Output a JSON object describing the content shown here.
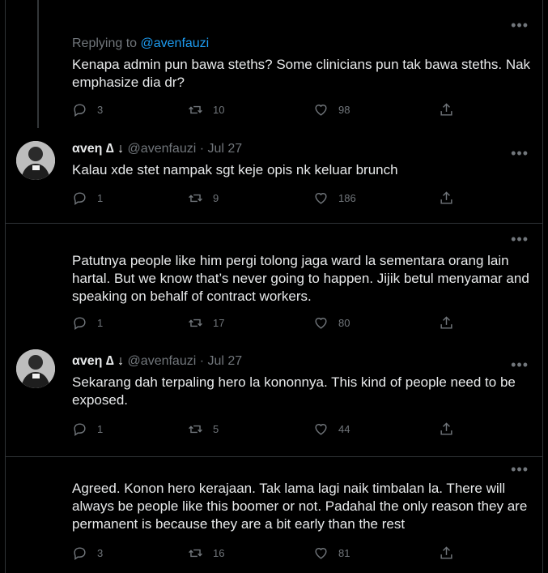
{
  "tweets": [
    {
      "replying_label": "Replying to",
      "replying_handle": "@avenfauzi",
      "text": "Kenapa admin pun bawa steths? Some clinicians pun tak bawa steths. Nak emphasize dia dr?",
      "replies": "3",
      "retweets": "10",
      "likes": "98"
    },
    {
      "name": "αveη ∆",
      "handle": "@avenfauzi",
      "date": "· Jul 27",
      "text": "Kalau xde stet nampak sgt keje opis nk keluar brunch",
      "replies": "1",
      "retweets": "9",
      "likes": "186"
    },
    {
      "text": "Patutnya people like him pergi tolong jaga ward la sementara orang lain hartal. But we know that’s never going to happen. Jijik betul menyamar and speaking on behalf of contract workers.",
      "replies": "1",
      "retweets": "17",
      "likes": "80"
    },
    {
      "name": "αveη ∆",
      "handle": "@avenfauzi",
      "date": "· Jul 27",
      "text": "Sekarang dah terpaling hero la kononnya. This kind of people need to be exposed.",
      "replies": "1",
      "retweets": "5",
      "likes": "44"
    },
    {
      "text": "Agreed. Konon hero kerajaan. Tak lama lagi naik timbalan la. There will always be people like this boomer or not. Padahal the only reason they are permanent is because they are a bit early than the rest",
      "replies": "3",
      "retweets": "16",
      "likes": "81"
    }
  ],
  "icons": {
    "more": "more-icon",
    "reply": "reply-icon",
    "retweet": "retweet-icon",
    "like": "heart-icon",
    "share": "share-icon"
  },
  "colors": {
    "background": "#000000",
    "text": "#e7e9ea",
    "muted": "#71767b",
    "link": "#1d9bf0"
  }
}
